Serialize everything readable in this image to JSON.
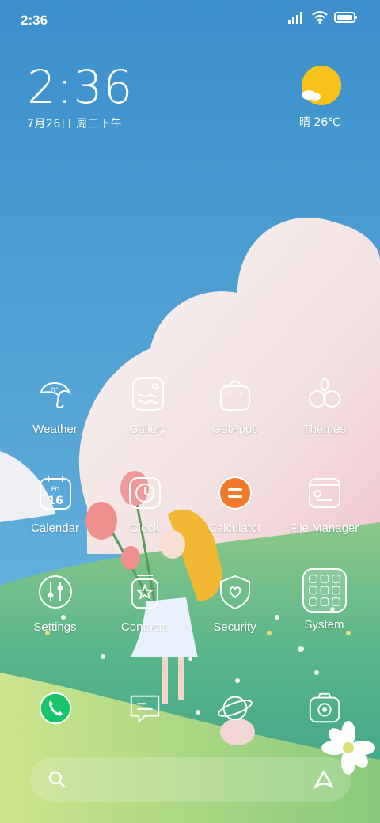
{
  "status_bar": {
    "time": "2:36"
  },
  "lockclock": {
    "time": "2:36",
    "date": "7月26日 周三下午"
  },
  "weather_widget": {
    "text": "晴 26℃"
  },
  "apps": [
    {
      "label": "Weather",
      "icon": "weather-icon"
    },
    {
      "label": "Gallery",
      "icon": "gallery-icon"
    },
    {
      "label": "GetApps",
      "icon": "getapps-icon"
    },
    {
      "label": "Themes",
      "icon": "themes-icon"
    },
    {
      "label": "Calendar",
      "icon": "calendar-icon",
      "calendar_day_name": "Fri",
      "calendar_day": "16"
    },
    {
      "label": "Clock",
      "icon": "clock-icon"
    },
    {
      "label": "Calculator",
      "icon": "calculator-icon"
    },
    {
      "label": "File Manager",
      "icon": "file-manager-icon"
    },
    {
      "label": "Settings",
      "icon": "settings-icon"
    },
    {
      "label": "Contacts",
      "icon": "contacts-icon"
    },
    {
      "label": "Security",
      "icon": "security-icon"
    },
    {
      "label": "System",
      "icon": "system-folder-icon"
    }
  ],
  "dock": [
    {
      "icon": "phone-icon"
    },
    {
      "icon": "messages-icon"
    },
    {
      "icon": "browser-icon"
    },
    {
      "icon": "camera-icon"
    }
  ],
  "colors": {
    "sky": "#3f95cf",
    "accent_orange": "#f07a2a",
    "phone_green": "#19c46b",
    "sun": "#f7c21a"
  }
}
